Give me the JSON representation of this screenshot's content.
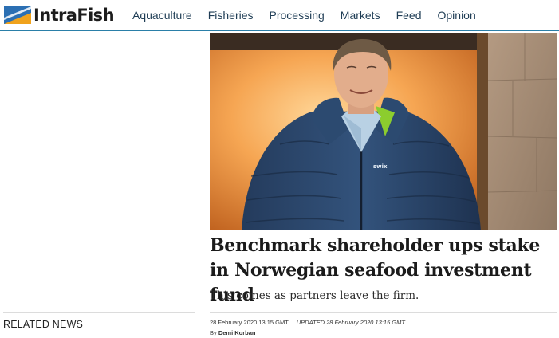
{
  "brand": {
    "name": "IntraFish"
  },
  "nav": {
    "items": [
      {
        "label": "Aquaculture"
      },
      {
        "label": "Fisheries"
      },
      {
        "label": "Processing"
      },
      {
        "label": "Markets"
      },
      {
        "label": "Feed"
      },
      {
        "label": "Opinion"
      }
    ]
  },
  "article": {
    "headline": "Benchmark shareholder ups stake in Norwegian seafood investment fund",
    "subheadline": "This comes as partners leave the firm.",
    "published": "28 February 2020 13:15 GMT",
    "updated": "UPDATED 28 February 2020 13:15 GMT",
    "byline_prefix": "By ",
    "author": "Demi Korban",
    "jacket_brand": "swix"
  },
  "sidebar": {
    "related_heading": "RELATED NEWS"
  },
  "colors": {
    "accent": "#2a7fa8",
    "logo_blue": "#2b6fb3",
    "logo_orange": "#f0a21c"
  }
}
